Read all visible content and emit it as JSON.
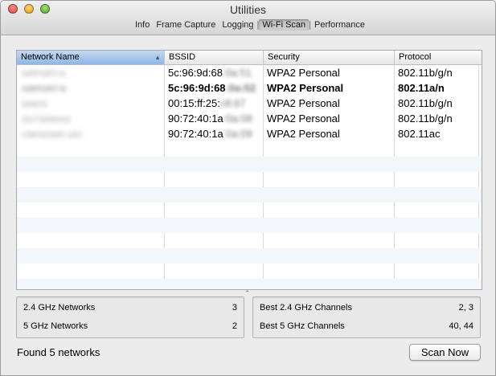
{
  "window": {
    "title": "Utilities"
  },
  "tabs": [
    {
      "label": "Info",
      "active": false
    },
    {
      "label": "Frame Capture",
      "active": false
    },
    {
      "label": "Logging",
      "active": false
    },
    {
      "label": "Wi-Fi Scan",
      "active": true
    },
    {
      "label": "Performance",
      "active": false
    }
  ],
  "table": {
    "columns": [
      "Network Name",
      "BSSID",
      "Security",
      "Protocol"
    ],
    "rows": [
      {
        "name": "AIRPORT-N",
        "bssid": "5c:96:9d:68",
        "bssid_hidden": ":0a:51",
        "security": "WPA2 Personal",
        "protocol": "802.11b/g/n",
        "bold": false
      },
      {
        "name": "AIRPORT-N",
        "bssid": "5c:96:9d:68",
        "bssid_hidden": ":0a:52",
        "security": "WPA2 Personal",
        "protocol": "802.11a/n",
        "bold": true
      },
      {
        "name": "DINOS",
        "bssid": "00:15:ff:25:",
        "bssid_hidden": "c8:67",
        "security": "WPA2 Personal",
        "protocol": "802.11b/g/n",
        "bold": false
      },
      {
        "name": "OUTSPANAS",
        "bssid": "90:72:40:1a",
        "bssid_hidden": ":0a:08",
        "security": "WPA2 Personal",
        "protocol": "802.11b/g/n",
        "bold": false
      },
      {
        "name": "UNKNOWN-1AC",
        "bssid": "90:72:40:1a",
        "bssid_hidden": ":0a:09",
        "security": "WPA2 Personal",
        "protocol": "802.11ac",
        "bold": false
      }
    ]
  },
  "stats_left": [
    {
      "label": "2.4 GHz Networks",
      "value": "3"
    },
    {
      "label": "5 GHz Networks",
      "value": "2"
    }
  ],
  "stats_right": [
    {
      "label": "Best 2.4 GHz Channels",
      "value": "2, 3"
    },
    {
      "label": "Best 5 GHz Channels",
      "value": "40, 44"
    }
  ],
  "status": "Found 5 networks",
  "scan_button": "Scan Now"
}
